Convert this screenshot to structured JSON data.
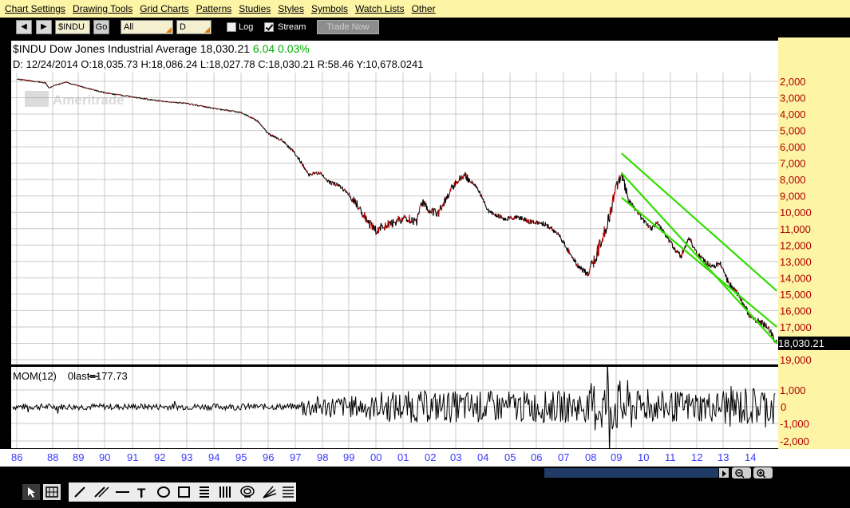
{
  "menu": [
    "Chart Settings",
    "Drawing Tools",
    "Grid Charts",
    "Patterns",
    "Studies",
    "Styles",
    "Symbols",
    "Watch Lists",
    "Other"
  ],
  "toolbar": {
    "back": "◀",
    "forward": "▶",
    "symbol_value": "$INDU",
    "go_label": "Go",
    "range_value": "All",
    "period_value": "D",
    "log_label": "Log",
    "log_checked": false,
    "stream_label": "Stream",
    "stream_checked": true,
    "trade_now_label": "Trade Now"
  },
  "header": {
    "title": "$INDU Dow Jones Industrial Average",
    "last": "18,030.21",
    "change": "6.04",
    "change_pct": "0.03%",
    "ohlc_line": "D:  12/24/2014  O:18,035.73  H:18,086.24  L:18,027.78  C:18,030.21  R:58.46    Y:10,678.0241",
    "change_color": "#00b000"
  },
  "watermark": "Ameritrade",
  "price_badge": "18,030.21",
  "momentum": {
    "label": "MOM(12)",
    "legend": "0last=177.73",
    "y_labels": [
      "1,000",
      "0",
      "-1,000",
      "-2,000"
    ]
  },
  "chart_data": {
    "type": "line",
    "title": "$INDU Dow Jones Industrial Average",
    "y_tick_labels": [
      "2,000",
      "3,000",
      "4,000",
      "5,000",
      "6,000",
      "7,000",
      "8,000",
      "9,000",
      "10,000",
      "11,000",
      "12,000",
      "13,000",
      "14,000",
      "15,000",
      "16,000",
      "17,000",
      "18,000",
      "19,000"
    ],
    "x_tick_labels": [
      "86",
      "88",
      "89",
      "90",
      "91",
      "92",
      "93",
      "94",
      "95",
      "96",
      "97",
      "98",
      "99",
      "00",
      "01",
      "02",
      "03",
      "04",
      "05",
      "06",
      "07",
      "08",
      "09",
      "10",
      "11",
      "12",
      "13",
      "14"
    ],
    "note_axis": "inverted (2,000 at top, 19,000 at bottom)",
    "ylim": [
      1500,
      19500
    ],
    "grid": true,
    "series": [
      {
        "color": "#000000",
        "x": [
          1986.0,
          1987.6,
          1987.8,
          1988.5,
          1990.0,
          1991.0,
          1992.0,
          1993.0,
          1994.0,
          1995.0,
          1995.6,
          1996.0,
          1996.5,
          1997.0,
          1997.5,
          1997.9,
          1998.3,
          1998.6,
          1999.0,
          1999.4,
          1999.7,
          2000.0,
          2000.4,
          2000.8,
          2001.2,
          2001.5,
          2001.7,
          2002.0,
          2002.3,
          2002.6,
          2002.9,
          2003.3,
          2003.8,
          2004.2,
          2004.8,
          2005.3,
          2005.8,
          2006.3,
          2006.8,
          2007.2,
          2007.5,
          2007.9,
          2008.3,
          2008.7,
          2009.0,
          2009.2,
          2009.5,
          2009.9,
          2010.3,
          2010.5,
          2010.9,
          2011.2,
          2011.4,
          2011.7,
          2012.0,
          2012.3,
          2012.6,
          2012.9,
          2013.2,
          2013.6,
          2014.0,
          2014.3,
          2014.7,
          2014.98
        ],
        "values": [
          1850,
          2100,
          2400,
          2050,
          2700,
          2950,
          3200,
          3350,
          3650,
          3900,
          4400,
          5200,
          5600,
          6400,
          7700,
          7600,
          8200,
          8300,
          8900,
          9700,
          10600,
          11100,
          10800,
          10500,
          10400,
          10600,
          9400,
          9900,
          10100,
          9200,
          8400,
          7700,
          8500,
          9900,
          10400,
          10300,
          10600,
          10700,
          11300,
          12400,
          13200,
          13800,
          12300,
          10500,
          8500,
          7700,
          9300,
          10300,
          11000,
          10600,
          11600,
          12300,
          12700,
          11500,
          12500,
          13000,
          13300,
          13100,
          14300,
          15100,
          16400,
          16600,
          17100,
          18030
        ],
        "name": ""
      }
    ],
    "channels": [
      {
        "x": [
          2009.2,
          2014.98
        ],
        "values": [
          6400,
          14800
        ]
      },
      {
        "x": [
          2009.2,
          2014.98
        ],
        "values": [
          7600,
          18000
        ]
      },
      {
        "x": [
          2009.2,
          2014.98
        ],
        "values": [
          9100,
          17000
        ]
      }
    ]
  },
  "chart_style": {
    "price_color": "#000000",
    "up_color": "#c00000",
    "channel_color": "#33dd00",
    "grid_color": "#c8c8c8",
    "axis_label_color": "#b00000",
    "x_label_color": "#3a3aff"
  }
}
